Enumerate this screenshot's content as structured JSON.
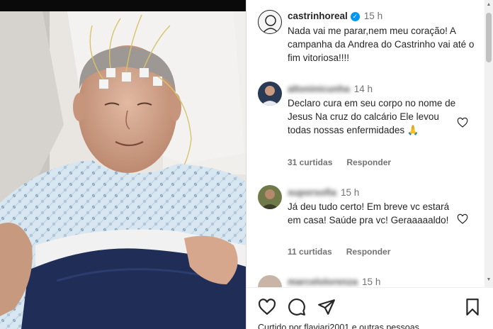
{
  "post": {
    "author": "castrinhoreal",
    "time": "15 h",
    "caption": "Nada vai me parar,nem meu coração! A campanha da Andrea do Castrinho vai até o fim vitoriosa!!!!"
  },
  "comments": [
    {
      "username": "altoninicunha",
      "time": "14 h",
      "text": "Declaro cura em seu corpo no nome de Jesus Na cruz do calcário Ele levou todas nossas enfermidades 🙏",
      "likes": "31 curtidas",
      "reply": "Responder"
    },
    {
      "username": "suporsofia",
      "time": "15 h",
      "text": "Já deu tudo certo! Em breve vc estará em casa! Saúde pra vc! Geraaaaaldo!",
      "likes": "11 curtidas",
      "reply": "Responder"
    },
    {
      "username": "marcelolorenza",
      "time": "15 h"
    }
  ],
  "liked_by": "Curtido por flaviari2001 e outras pessoas",
  "icons": {
    "like": "heart-icon",
    "comment": "comment-icon",
    "share": "send-icon",
    "save": "bookmark-icon",
    "verified": "verified-badge-icon"
  },
  "colors": {
    "text": "#262626",
    "secondary": "#737373",
    "verified": "#0095f6",
    "gown": "#cfe1ee",
    "blanket": "#1f2d57"
  }
}
